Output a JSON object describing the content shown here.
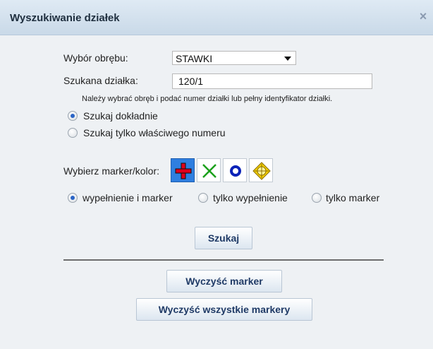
{
  "dialog": {
    "title": "Wyszukiwanie działek",
    "close_symbol": "×"
  },
  "form": {
    "district_label": "Wybór obrębu:",
    "district_value": "STAWKI",
    "parcel_label": "Szukana działka:",
    "parcel_value": "120/1",
    "hint": "Należy wybrać obręb i podać numer działki lub pełny identyfikator działki.",
    "search_mode": {
      "exact": "Szukaj dokładnie",
      "own_number": "Szukaj tylko właściwego numeru",
      "selected": "exact"
    },
    "marker_label": "Wybierz marker/kolor:",
    "markers": [
      {
        "name": "red-cross-marker-icon",
        "color": "#e0001b",
        "selected": true
      },
      {
        "name": "green-x-marker-icon",
        "color": "#1aa01a",
        "selected": false
      },
      {
        "name": "blue-ring-marker-icon",
        "color": "#0a22b8",
        "selected": false
      },
      {
        "name": "yellow-target-marker-icon",
        "color": "#f4d000",
        "selected": false
      }
    ],
    "display_mode": {
      "fill_and_marker": "wypełnienie i marker",
      "fill_only": "tylko wypełnienie",
      "marker_only": "tylko marker",
      "selected": "fill_and_marker"
    }
  },
  "buttons": {
    "search": "Szukaj",
    "clear_marker": "Wyczyść marker",
    "clear_all_markers": "Wyczyść wszystkie markery"
  }
}
